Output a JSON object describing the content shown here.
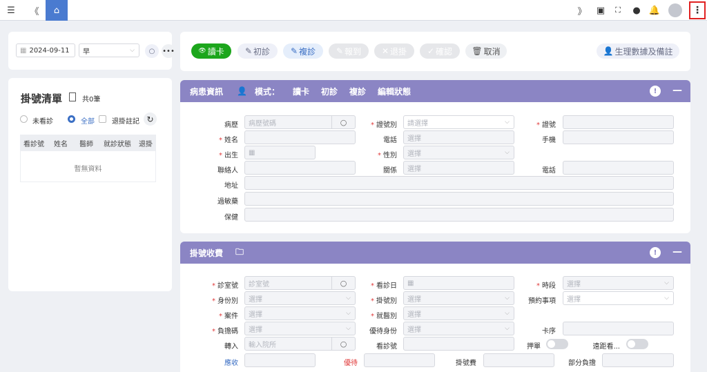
{
  "topbar": {
    "menu_icon": "list-icon",
    "back_icon": "double-chevron-left-icon",
    "home_icon": "home-icon",
    "forward_icon": "double-chevron-right-icon",
    "right_icons": [
      "search-doc-icon",
      "fullscreen-icon",
      "chat-icon",
      "bell-icon"
    ]
  },
  "filter": {
    "date": "2024-09-11",
    "session": "早"
  },
  "register_list": {
    "title": "掛號清單",
    "count": "共0筆",
    "radio_unseen": "未看診",
    "radio_all": "全部",
    "check_cancel": "退掛註記",
    "columns": [
      "看診號",
      "姓名",
      "醫師",
      "就診狀態",
      "退掛"
    ],
    "empty": "暫無資料"
  },
  "actions": {
    "read_card": "讀卡",
    "first_visit": "初診",
    "revisit": "複診",
    "report": "報到",
    "cancel_reg": "退掛",
    "confirm": "確認",
    "cancel": "取消",
    "vitals": "生理數據及備註"
  },
  "patient_section": {
    "title": "病患資訊",
    "mode_label": "模式：",
    "modes": [
      "讀卡",
      "初診",
      "複診",
      "編輯狀態"
    ],
    "fields": {
      "chart": "病歷",
      "chart_ph": "病歷號碼",
      "id_type": "證號別",
      "id_type_ph": "請選擇",
      "id_no": "證號",
      "name": "姓名",
      "phone": "電話",
      "phone_ph": "選擇",
      "mobile": "手機",
      "birth": "出生",
      "gender": "性別",
      "gender_ph": "選擇",
      "contact": "聯絡人",
      "relation": "關係",
      "relation_ph": "選擇",
      "contact_phone": "電話",
      "address": "地址",
      "allergy": "過敏藥",
      "insurance": "保健"
    }
  },
  "registration_section": {
    "title": "掛號收費",
    "fields": {
      "room": "診室號",
      "room_ph": "診室號",
      "visit_date": "看診日",
      "period": "時段",
      "period_ph": "選擇",
      "identity": "身份別",
      "identity_ph": "選擇",
      "reg_type": "掛號別",
      "reg_type_ph": "選擇",
      "appointment": "預約事項",
      "appointment_ph": "選擇",
      "case": "案件",
      "case_ph": "選擇",
      "medical_type": "就醫別",
      "medical_type_ph": "選擇",
      "burden": "負擔碼",
      "burden_ph": "選擇",
      "preferential": "優待身份",
      "preferential_ph": "選擇",
      "card_seq": "卡序",
      "referral": "轉入",
      "referral_ph": "輸入院所",
      "visit_no": "看診號",
      "deposit": "押單",
      "remote": "遠距看...",
      "receivable": "應收",
      "discount": "優待",
      "reg_fee": "掛號費",
      "copay": "部分負擔"
    }
  }
}
